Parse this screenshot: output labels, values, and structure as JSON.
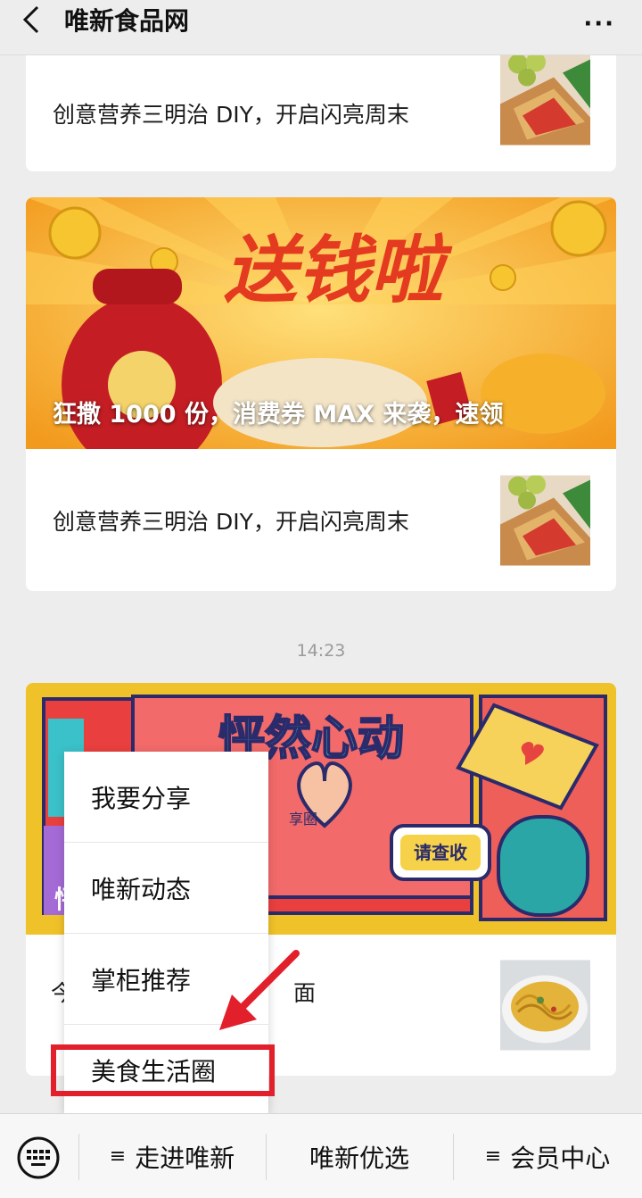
{
  "header": {
    "title": "唯新食品网",
    "more": "···"
  },
  "articles": {
    "top_item": {
      "title": "创意营养三明治 DIY，开启闪亮周末"
    },
    "banner1": {
      "text": "送钱啦",
      "caption": "狂撒 1000 份，消费券 MAX 来袭，速领"
    },
    "item2": {
      "title": "创意营养三明治 DIY，开启闪亮周末"
    },
    "timestamp": "14:23",
    "banner2": {
      "text": "怦然心动",
      "badge": "请查收",
      "sticker_fragment": "享圈",
      "caption_fragment": "怦"
    },
    "item3": {
      "title_left": "今",
      "title_right": "面"
    }
  },
  "menu": {
    "items": [
      {
        "label": "我要分享"
      },
      {
        "label": "唯新动态"
      },
      {
        "label": "掌柜推荐"
      },
      {
        "label": "美食生活圈"
      }
    ]
  },
  "bottombar": {
    "menu_icon": "≡",
    "items": [
      {
        "label": "走进唯新"
      },
      {
        "label": "唯新优选"
      },
      {
        "label": "会员中心"
      }
    ]
  },
  "colors": {
    "highlight": "#e2202b",
    "accent_banner": "#f6a623"
  }
}
